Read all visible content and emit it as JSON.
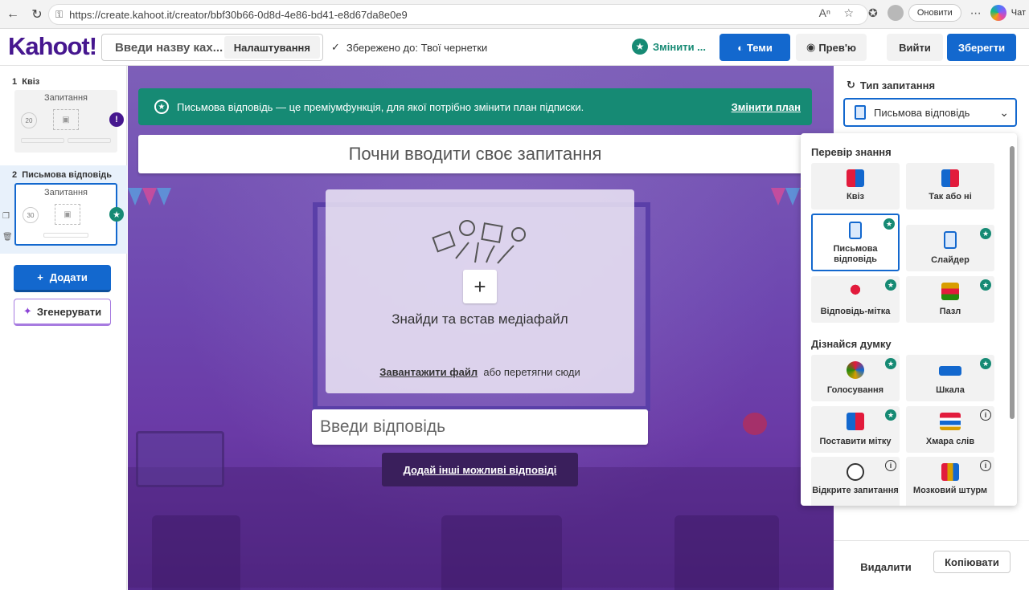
{
  "browser": {
    "url": "https://create.kahoot.it/creator/bbf30b66-0d8d-4e86-bd41-e8d67da8e0e9",
    "update_label": "Оновити",
    "chat_label": "Чат"
  },
  "header": {
    "logo": "Kahoot!",
    "title_placeholder": "Введи назву ках...",
    "settings_label": "Налаштування",
    "saved_text": "Збережено до: Твої чернетки",
    "change_plan_label": "Змінити ...",
    "themes_label": "Теми",
    "preview_label": "Прев'ю",
    "exit_label": "Вийти",
    "save_label": "Зберегти"
  },
  "sidebar": {
    "slides": [
      {
        "number": "1",
        "type": "Квіз",
        "thumb_title": "Запитання",
        "timer": "20"
      },
      {
        "number": "2",
        "type": "Письмова відповідь",
        "thumb_title": "Запитання",
        "timer": "30"
      }
    ],
    "add_label": "Додати",
    "generate_label": "Згенерувати"
  },
  "canvas": {
    "premium_text": "Письмова відповідь — це преміумфункція, для якої потрібно змінити план підписки.",
    "premium_link": "Змінити план",
    "question_placeholder": "Почни вводити своє запитання",
    "media_title": "Знайди та встав медіафайл",
    "upload_link": "Завантажити файл",
    "upload_rest": "або перетягни сюди",
    "answer_placeholder": "Введи відповідь",
    "add_answers_label": "Додай інші можливі відповіді"
  },
  "right_panel": {
    "question_type_label": "Тип запитання",
    "selected_type": "Письмова відповідь",
    "delete_label": "Видалити",
    "copy_label": "Копіювати"
  },
  "dropdown": {
    "section1": "Перевір знання",
    "section2": "Дізнайся думку",
    "items1": [
      {
        "label": "Квіз",
        "badge": ""
      },
      {
        "label": "Так або ні",
        "badge": ""
      },
      {
        "label": "Письмова відповідь",
        "badge": "premium"
      },
      {
        "label": "Слайдер",
        "badge": "premium"
      },
      {
        "label": "Відповідь-мітка",
        "badge": "premium"
      },
      {
        "label": "Пазл",
        "badge": "premium"
      }
    ],
    "items2": [
      {
        "label": "Голосування",
        "badge": "premium"
      },
      {
        "label": "Шкала",
        "badge": "premium"
      },
      {
        "label": "Поставити мітку",
        "badge": "premium"
      },
      {
        "label": "Хмара слів",
        "badge": "info"
      },
      {
        "label": "Відкрите запитання",
        "badge": "info"
      },
      {
        "label": "Мозковий штурм",
        "badge": "info"
      }
    ]
  },
  "colors": {
    "brand_purple": "#46178f",
    "primary_blue": "#1368ce",
    "premium_green": "#168a74"
  }
}
